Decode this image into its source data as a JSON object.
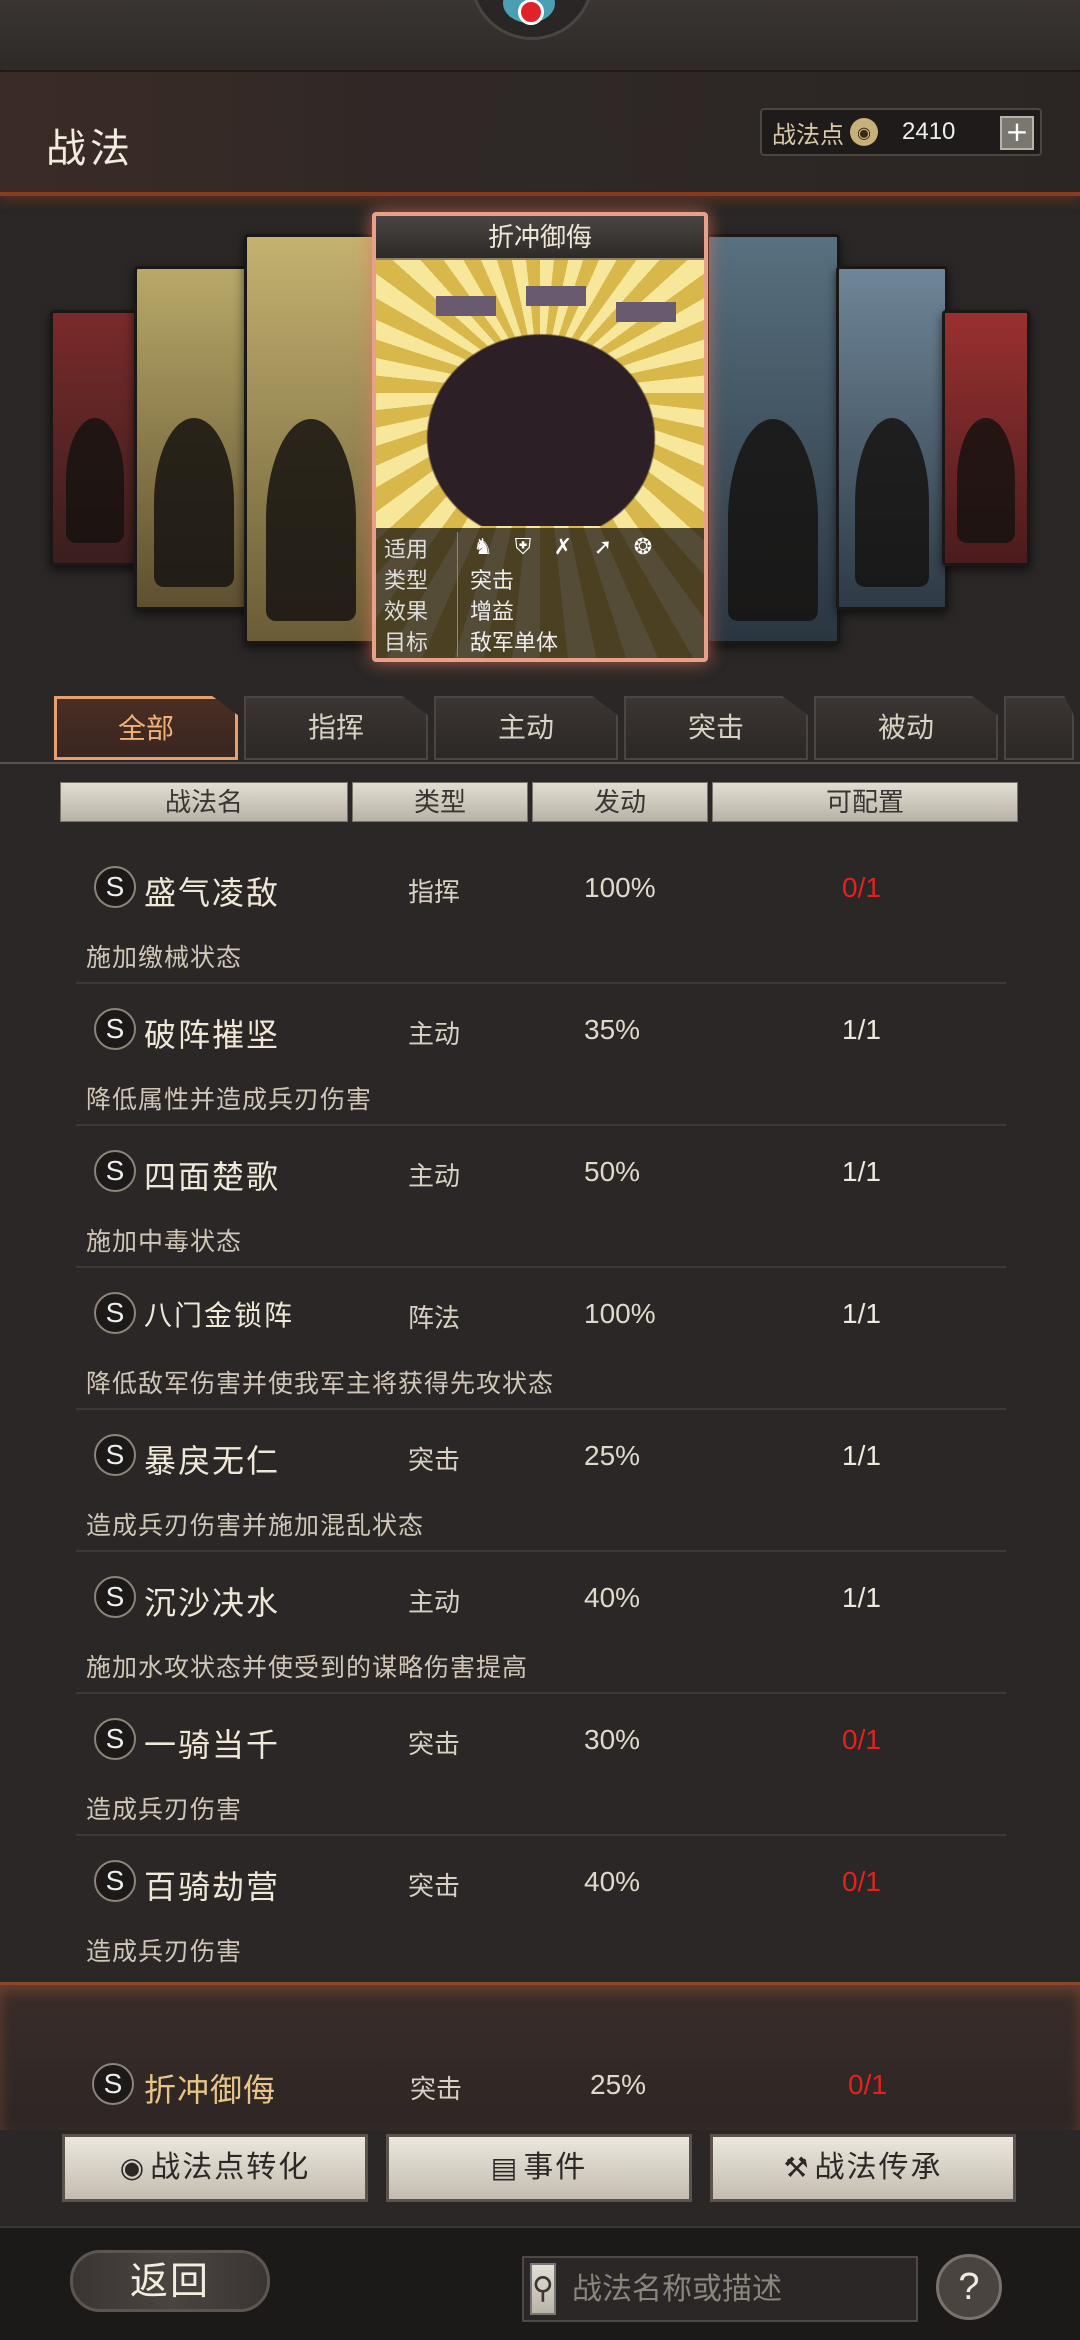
{
  "header": {
    "title": "战法",
    "points_label": "战法点",
    "points_value": "2410",
    "plus_symbol": "+"
  },
  "featured_card": {
    "name": "折冲御侮",
    "rows": [
      {
        "key": "适用",
        "value": ""
      },
      {
        "key": "类型",
        "value": "突击"
      },
      {
        "key": "效果",
        "value": "增益"
      },
      {
        "key": "目标",
        "value": "敌军单体"
      }
    ],
    "applicable_icons": [
      "cavalry-icon",
      "shield-icon",
      "bow-icon",
      "spear-icon",
      "wheel-icon"
    ]
  },
  "tabs": [
    {
      "label": "全部",
      "active": true
    },
    {
      "label": "指挥",
      "active": false
    },
    {
      "label": "主动",
      "active": false
    },
    {
      "label": "突击",
      "active": false
    },
    {
      "label": "被动",
      "active": false
    }
  ],
  "columns": [
    "战法名",
    "类型",
    "发动",
    "可配置"
  ],
  "tactics": [
    {
      "grade": "S",
      "name": "盛气凌敌",
      "type": "指挥",
      "rate": "100%",
      "config": "0/1",
      "config_red": true,
      "desc": "施加缴械状态"
    },
    {
      "grade": "S",
      "name": "破阵摧坚",
      "type": "主动",
      "rate": "35%",
      "config": "1/1",
      "config_red": false,
      "desc": "降低属性并造成兵刃伤害"
    },
    {
      "grade": "S",
      "name": "四面楚歌",
      "type": "主动",
      "rate": "50%",
      "config": "1/1",
      "config_red": false,
      "desc": "施加中毒状态"
    },
    {
      "grade": "S",
      "name": "八门金锁阵",
      "type": "阵法",
      "rate": "100%",
      "config": "1/1",
      "config_red": false,
      "desc": "降低敌军伤害并使我军主将获得先攻状态"
    },
    {
      "grade": "S",
      "name": "暴戾无仁",
      "type": "突击",
      "rate": "25%",
      "config": "1/1",
      "config_red": false,
      "desc": "造成兵刃伤害并施加混乱状态"
    },
    {
      "grade": "S",
      "name": "沉沙决水",
      "type": "主动",
      "rate": "40%",
      "config": "1/1",
      "config_red": false,
      "desc": "施加水攻状态并使受到的谋略伤害提高"
    },
    {
      "grade": "S",
      "name": "一骑当千",
      "type": "突击",
      "rate": "30%",
      "config": "0/1",
      "config_red": true,
      "desc": "造成兵刃伤害"
    },
    {
      "grade": "S",
      "name": "百骑劫营",
      "type": "突击",
      "rate": "40%",
      "config": "0/1",
      "config_red": true,
      "desc": "造成兵刃伤害"
    }
  ],
  "selected": {
    "grade": "S",
    "name": "折冲御侮",
    "type": "突击",
    "rate": "25%",
    "config": "0/1"
  },
  "actions": [
    {
      "icon": "coin-icon",
      "label": "战法点转化"
    },
    {
      "icon": "scroll-icon",
      "label": "事件"
    },
    {
      "icon": "hammer-icon",
      "label": "战法传承"
    }
  ],
  "bottom": {
    "back_label": "返回",
    "search_placeholder": "战法名称或描述",
    "help_symbol": "?"
  },
  "colors": {
    "accent": "#e6a070",
    "warning_red": "#e0231f",
    "header_border": "#8a3a1f"
  }
}
